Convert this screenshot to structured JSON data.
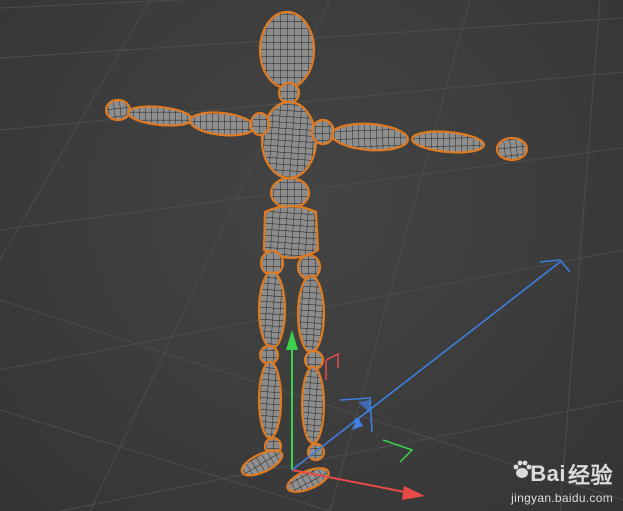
{
  "viewport": {
    "background": "#3a3a3a",
    "grid_color": "#4c4c4c",
    "selection_outline": "#e07a20",
    "mesh_fill": "#8a8a8a",
    "mesh_wire": "#1e1e1e",
    "object": "mannequin-mesh",
    "selected": true
  },
  "gizmo": {
    "x_axis_color": "#e84a4a",
    "y_axis_color": "#3bd14a",
    "z_axis_color": "#3f7fe0"
  },
  "watermark": {
    "brand_left": "Bai",
    "brand_right": "经验",
    "url": "jingyan.baidu.com",
    "logo": "paw-icon"
  }
}
